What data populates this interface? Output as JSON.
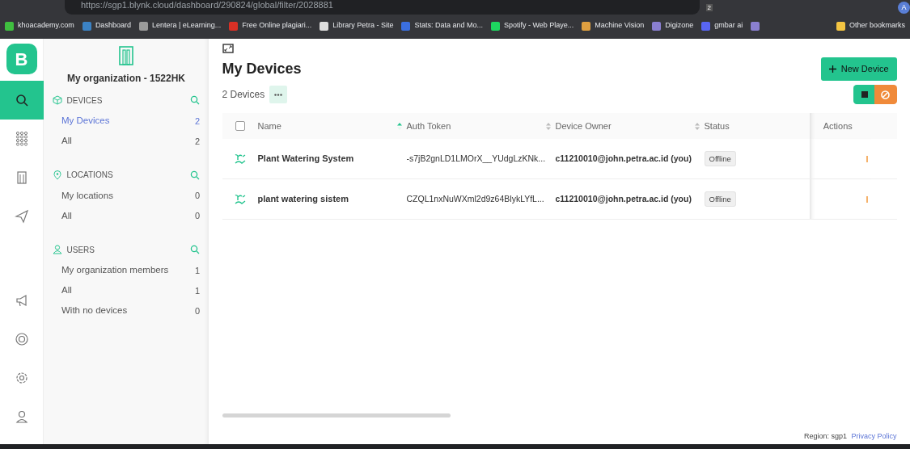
{
  "browser": {
    "url": "https://sgp1.blynk.cloud/dashboard/290824/global/filter/2028881",
    "extension_badge": "2",
    "profile_initial": "A",
    "bookmarks": [
      {
        "label": "khoacademy.com",
        "color": "#3fbf3f"
      },
      {
        "label": "Dashboard",
        "color": "#3b82c4"
      },
      {
        "label": "Lentera | eLearning...",
        "color": "#9a9a9a"
      },
      {
        "label": "Free Online plagiari...",
        "color": "#d93025"
      },
      {
        "label": "Library Petra - Site",
        "color": "#dddddd"
      },
      {
        "label": "Stats: Data and Mo...",
        "color": "#3b6fe0"
      },
      {
        "label": "Spotify - Web Playe...",
        "color": "#1ed760"
      },
      {
        "label": "Machine Vision",
        "color": "#e0a040"
      },
      {
        "label": "Digizone",
        "color": "#8a7fd0"
      },
      {
        "label": "gmbar ai",
        "color": "#5865f2"
      },
      {
        "color": "#8a7fd0"
      }
    ],
    "other_bookmarks": "Other bookmarks"
  },
  "logo": "B",
  "rail": [
    {
      "kind": "search",
      "selected": true
    },
    {
      "kind": "grid",
      "selected": false
    },
    {
      "kind": "building",
      "selected": false
    },
    {
      "kind": "send",
      "selected": false
    },
    {
      "kind": "megaphone",
      "selected": false
    },
    {
      "kind": "lifebuoy",
      "selected": false
    },
    {
      "kind": "gear",
      "selected": false
    },
    {
      "kind": "user",
      "selected": false
    }
  ],
  "organization": "My organization - 1522HK",
  "sections": [
    {
      "kind": "devices",
      "title": "DEVICES",
      "items": [
        {
          "label": "My Devices",
          "count": "2",
          "selected": true
        },
        {
          "label": "All",
          "count": "2",
          "selected": false
        }
      ]
    },
    {
      "kind": "locations",
      "title": "LOCATIONS",
      "items": [
        {
          "label": "My locations",
          "count": "0",
          "selected": false
        },
        {
          "label": "All",
          "count": "0",
          "selected": false
        }
      ]
    },
    {
      "kind": "users",
      "title": "USERS",
      "items": [
        {
          "label": "My organization members",
          "count": "1",
          "selected": false
        },
        {
          "label": "All",
          "count": "1",
          "selected": false
        },
        {
          "label": "With no devices",
          "count": "0",
          "selected": false
        }
      ]
    }
  ],
  "page_title": "My Devices",
  "new_device": "New Device",
  "device_count": "2 Devices",
  "table": {
    "select_all_checked": false,
    "columns": [
      {
        "label": "Name",
        "sorted": true
      },
      {
        "label": "Auth Token",
        "sorted": false
      },
      {
        "label": "Device Owner",
        "sorted": false
      },
      {
        "label": "Status"
      },
      {
        "label": "Actions"
      }
    ],
    "rows": [
      {
        "name": "Plant Watering System",
        "token": "-s7jB2gnLD1LMOrX__YUdgLzKNk...",
        "owner": "c11210010@john.petra.ac.id (you)",
        "status": "Offline"
      },
      {
        "name": "plant watering sistem",
        "token": "CZQL1nxNuWXml2d9z64BlykLYfL...",
        "owner": "c11210010@john.petra.ac.id (you)",
        "status": "Offline"
      }
    ]
  },
  "footer": {
    "region": "Region: sgp1",
    "privacy": "Privacy Policy"
  }
}
